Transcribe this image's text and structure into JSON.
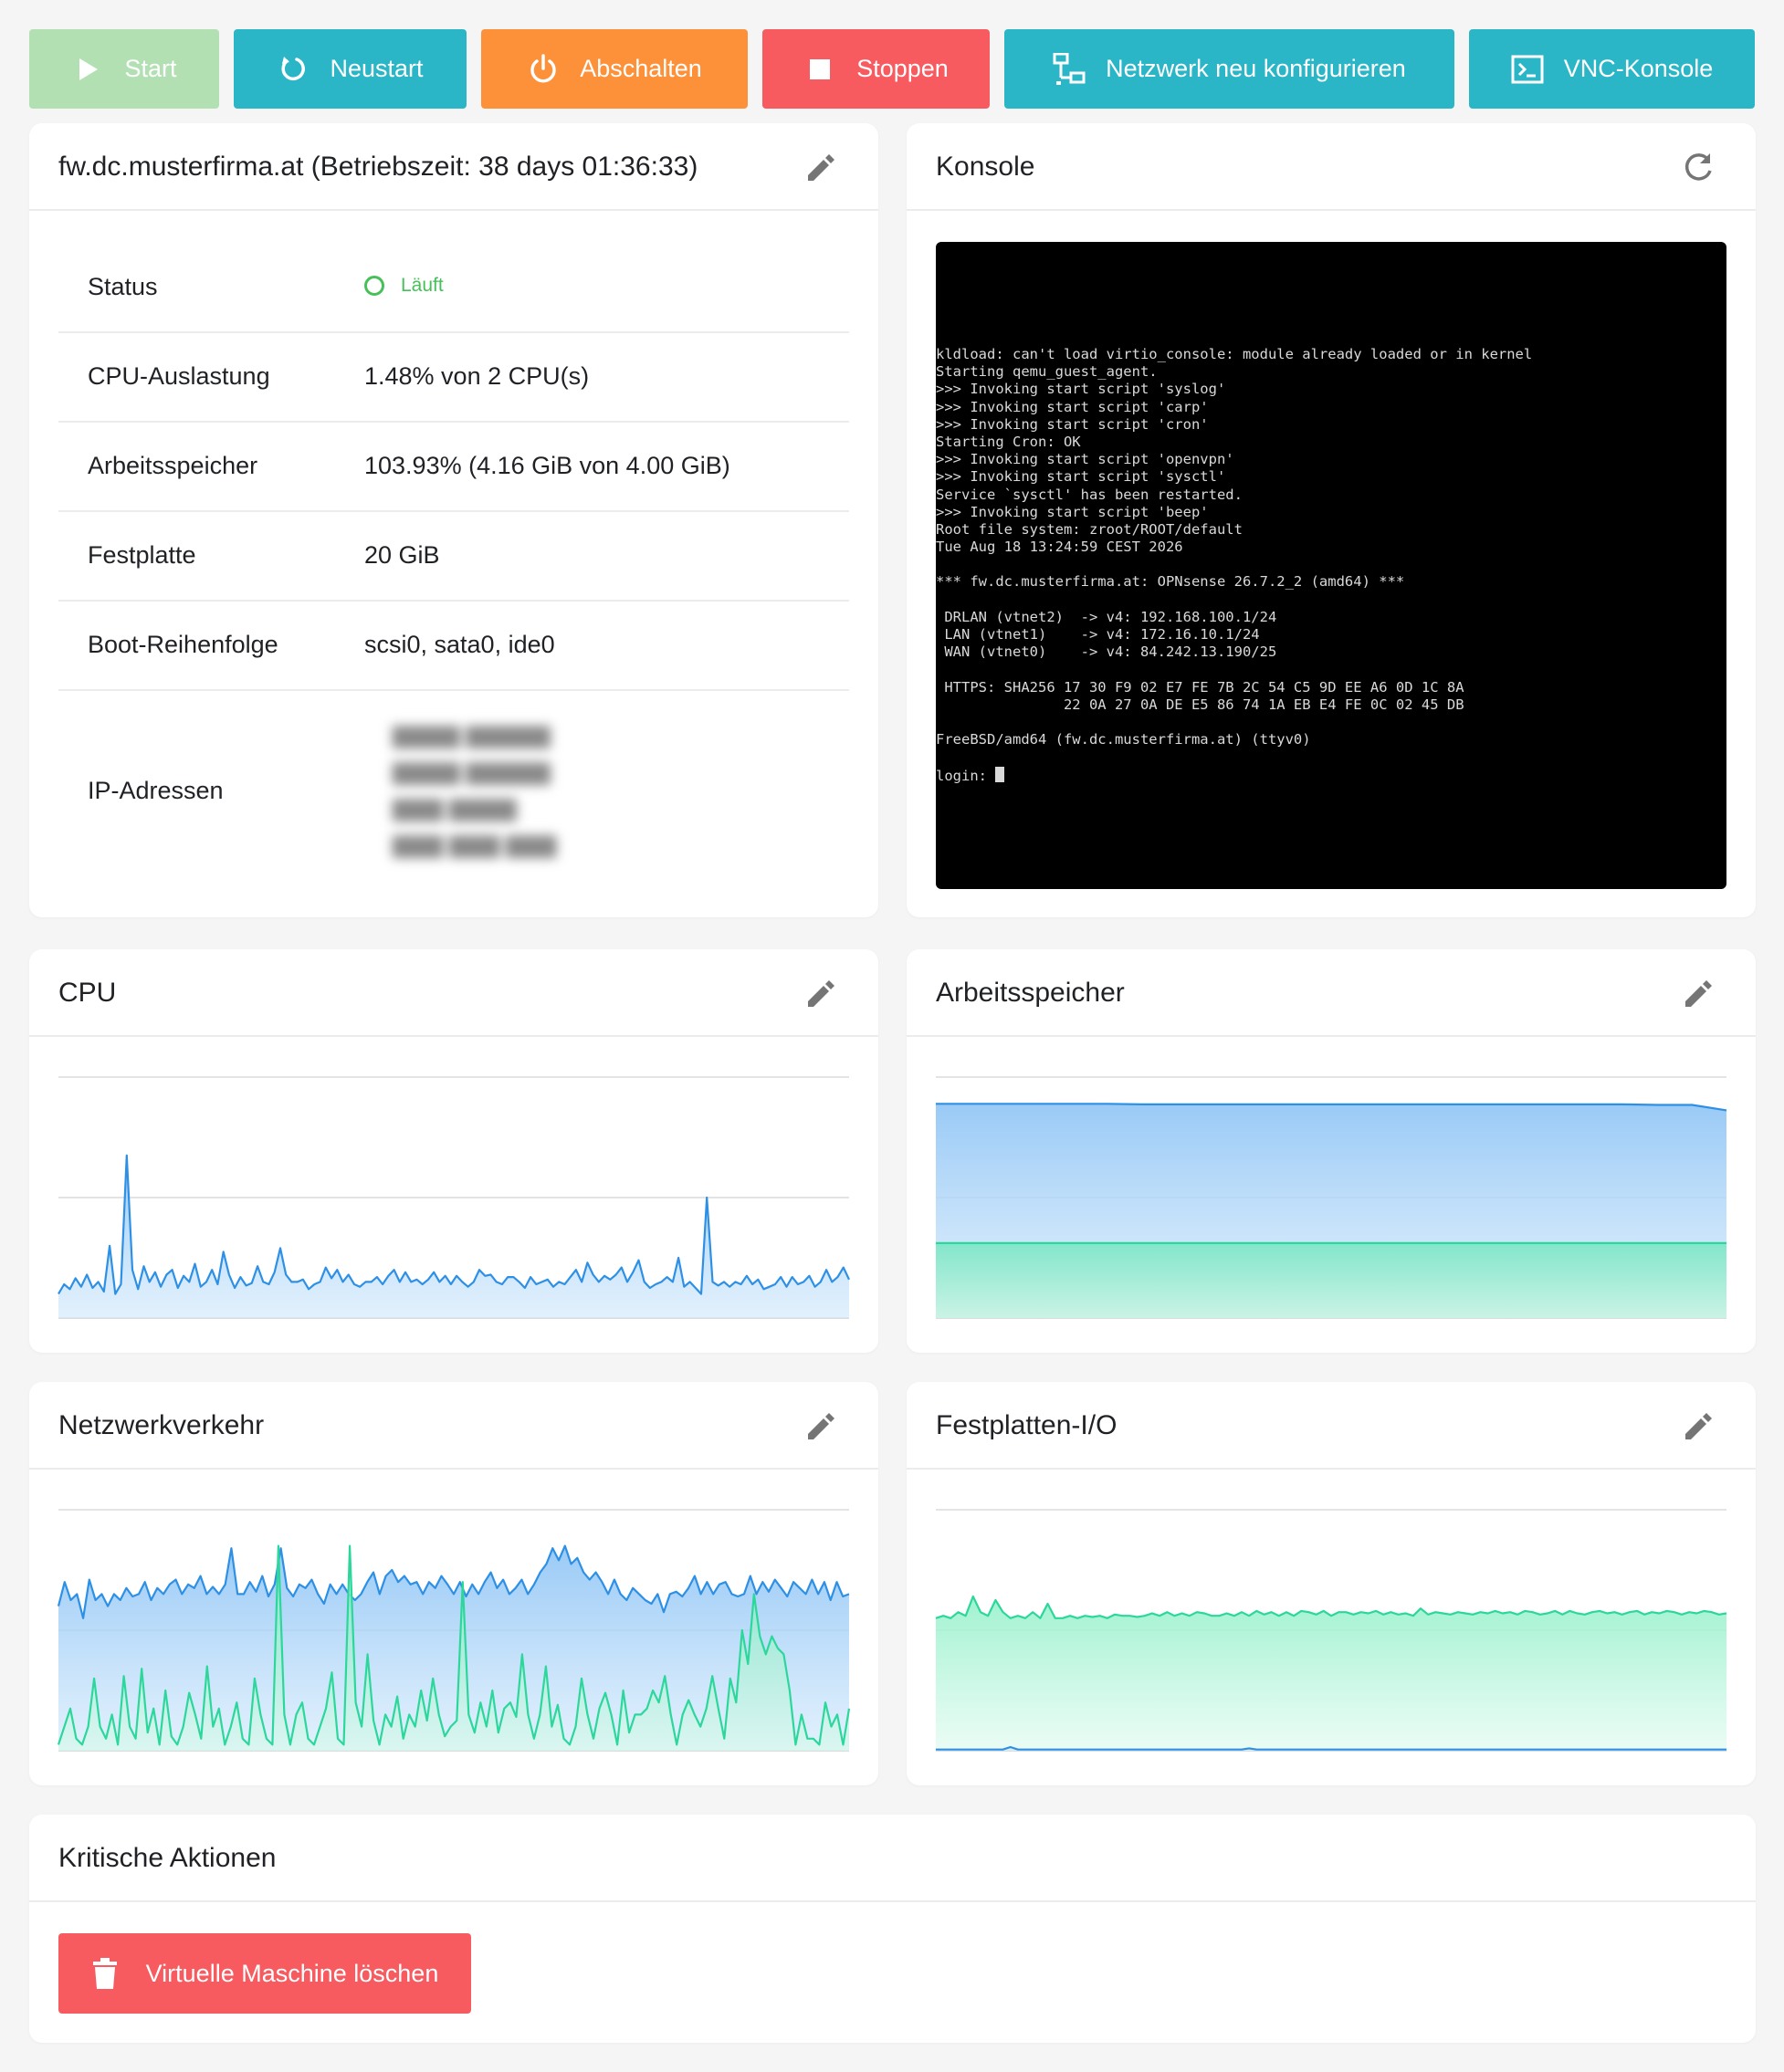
{
  "toolbar": {
    "start": "Start",
    "restart": "Neustart",
    "shutdown": "Abschalten",
    "stop": "Stoppen",
    "network": "Netzwerk neu konfigurieren",
    "vnc": "VNC-Konsole"
  },
  "colors": {
    "green": "#47c05a",
    "teal": "#2ab6c6",
    "orange": "#fd913a",
    "red": "#f75a5f",
    "blue_line": "#2e90e5",
    "green_line": "#2cd79b"
  },
  "summary": {
    "title": "fw.dc.musterfirma.at (Betriebszeit: 38 days 01:36:33)",
    "rows": {
      "status_label": "Status",
      "status_value": "Läuft",
      "cpu_label": "CPU-Auslastung",
      "cpu_value": "1.48% von 2 CPU(s)",
      "mem_label": "Arbeitsspeicher",
      "mem_value": "103.93% (4.16 GiB von 4.00 GiB)",
      "disk_label": "Festplatte",
      "disk_value": "20 GiB",
      "boot_label": "Boot-Reihenfolge",
      "boot_value": "scsi0, sata0, ide0",
      "ip_label": "IP-Adressen"
    }
  },
  "console": {
    "title": "Konsole",
    "lines": [
      "kldload: can't load virtio_console: module already loaded or in kernel",
      "Starting qemu_guest_agent.",
      ">>> Invoking start script 'syslog'",
      ">>> Invoking start script 'carp'",
      ">>> Invoking start script 'cron'",
      "Starting Cron: OK",
      ">>> Invoking start script 'openvpn'",
      ">>> Invoking start script 'sysctl'",
      "Service `sysctl' has been restarted.",
      ">>> Invoking start script 'beep'",
      "Root file system: zroot/ROOT/default",
      "Tue Aug 18 13:24:59 CEST 2026",
      "",
      "*** fw.dc.musterfirma.at: OPNsense 26.7.2_2 (amd64) ***",
      "",
      " DRLAN (vtnet2)  -> v4: 192.168.100.1/24",
      " LAN (vtnet1)    -> v4: 172.16.10.1/24",
      " WAN (vtnet0)    -> v4: 84.242.13.190/25",
      "",
      " HTTPS: SHA256 17 30 F9 02 E7 FE 7B 2C 54 C5 9D EE A6 0D 1C 8A",
      "               22 0A 27 0A DE E5 86 74 1A EB E4 FE 0C 02 45 DB",
      "",
      "FreeBSD/amd64 (fw.dc.musterfirma.at) (ttyv0)",
      "",
      "login: "
    ]
  },
  "cpu_card": {
    "title": "CPU"
  },
  "mem_card": {
    "title": "Arbeitsspeicher"
  },
  "net_card": {
    "title": "Netzwerkverkehr"
  },
  "disk_card": {
    "title": "Festplatten-I/O"
  },
  "critical": {
    "title": "Kritische Aktionen",
    "delete_label": "Virtuelle Maschine löschen"
  },
  "chart_data": [
    {
      "type": "area",
      "chart": "cpu",
      "grid": true,
      "ylim": [
        0,
        2
      ],
      "series": [
        {
          "values": [
            0.2,
            0.28,
            0.24,
            0.33,
            0.26,
            0.36,
            0.25,
            0.3,
            0.22,
            0.6,
            0.2,
            0.28,
            1.35,
            0.4,
            0.24,
            0.43,
            0.3,
            0.38,
            0.26,
            0.36,
            0.4,
            0.25,
            0.35,
            0.3,
            0.45,
            0.26,
            0.3,
            0.4,
            0.28,
            0.55,
            0.36,
            0.25,
            0.34,
            0.27,
            0.29,
            0.43,
            0.3,
            0.28,
            0.38,
            0.58,
            0.36,
            0.3,
            0.3,
            0.32,
            0.24,
            0.28,
            0.3,
            0.42,
            0.33,
            0.4,
            0.3,
            0.36,
            0.28,
            0.26,
            0.3,
            0.3,
            0.34,
            0.28,
            0.35,
            0.4,
            0.3,
            0.38,
            0.3,
            0.32,
            0.28,
            0.32,
            0.38,
            0.3,
            0.35,
            0.28,
            0.35,
            0.3,
            0.26,
            0.3,
            0.4,
            0.35,
            0.36,
            0.3,
            0.28,
            0.34,
            0.34,
            0.3,
            0.25,
            0.34,
            0.28,
            0.3,
            0.32,
            0.26,
            0.3,
            0.28,
            0.34,
            0.4,
            0.3,
            0.46,
            0.36,
            0.3,
            0.35,
            0.32,
            0.36,
            0.42,
            0.3,
            0.38,
            0.48,
            0.3,
            0.25,
            0.28,
            0.3,
            0.34,
            0.3,
            0.5,
            0.26,
            0.3,
            0.25,
            0.2,
            1.0,
            0.3,
            0.27,
            0.3,
            0.26,
            0.3,
            0.28,
            0.35,
            0.28,
            0.32,
            0.24,
            0.26,
            0.28,
            0.34,
            0.26,
            0.34,
            0.28,
            0.3,
            0.35,
            0.26,
            0.3,
            0.4,
            0.3,
            0.34,
            0.42,
            0.32
          ]
        }
      ]
    },
    {
      "type": "area",
      "chart": "memory",
      "grid": true,
      "ylim": [
        0,
        4.5
      ],
      "series": [
        {
          "name": "total",
          "values": [
            4.0,
            4.0,
            4.0,
            4.0,
            4.0,
            4.0,
            3.99,
            3.99,
            3.99,
            3.99,
            3.99,
            3.99,
            3.99,
            3.99,
            3.99,
            3.99,
            3.99,
            3.99,
            3.99,
            3.99,
            3.99,
            3.98,
            3.98,
            3.88
          ]
        },
        {
          "name": "used",
          "values": [
            1.4,
            1.4,
            1.4,
            1.4,
            1.4,
            1.4,
            1.4,
            1.4,
            1.4,
            1.4,
            1.4,
            1.4,
            1.4,
            1.4,
            1.4,
            1.4,
            1.4,
            1.4,
            1.4,
            1.4,
            1.4,
            1.4,
            1.4,
            1.4
          ]
        }
      ]
    },
    {
      "type": "area",
      "chart": "network",
      "grid": true,
      "ylim": [
        0,
        2
      ],
      "series": [
        {
          "name": "in",
          "values": [
            1.2,
            1.4,
            1.25,
            1.3,
            1.1,
            1.42,
            1.25,
            1.3,
            1.2,
            1.3,
            1.25,
            1.35,
            1.28,
            1.3,
            1.4,
            1.25,
            1.35,
            1.3,
            1.38,
            1.42,
            1.3,
            1.38,
            1.35,
            1.45,
            1.3,
            1.36,
            1.3,
            1.38,
            1.68,
            1.3,
            1.3,
            1.4,
            1.32,
            1.45,
            1.28,
            1.38,
            1.68,
            1.35,
            1.28,
            1.38,
            1.35,
            1.42,
            1.3,
            1.22,
            1.38,
            1.3,
            1.38,
            1.3,
            1.25,
            1.3,
            1.4,
            1.48,
            1.3,
            1.45,
            1.5,
            1.4,
            1.45,
            1.38,
            1.4,
            1.3,
            1.4,
            1.35,
            1.45,
            1.38,
            1.3,
            1.4,
            1.28,
            1.38,
            1.3,
            1.4,
            1.48,
            1.35,
            1.42,
            1.3,
            1.35,
            1.42,
            1.3,
            1.38,
            1.48,
            1.55,
            1.68,
            1.58,
            1.7,
            1.55,
            1.6,
            1.48,
            1.42,
            1.48,
            1.4,
            1.3,
            1.42,
            1.3,
            1.25,
            1.35,
            1.3,
            1.25,
            1.22,
            1.3,
            1.15,
            1.3,
            1.32,
            1.28,
            1.35,
            1.45,
            1.3,
            1.4,
            1.3,
            1.38,
            1.4,
            1.3,
            1.28,
            1.3,
            1.45,
            1.3,
            1.4,
            1.32,
            1.42,
            1.35,
            1.28,
            1.4,
            1.35,
            1.3,
            1.42,
            1.3,
            1.4,
            1.25,
            1.4,
            1.28,
            1.3
          ]
        },
        {
          "name": "out",
          "values": [
            0.05,
            0.2,
            0.35,
            0.1,
            0.05,
            0.2,
            0.6,
            0.2,
            0.1,
            0.3,
            0.05,
            0.62,
            0.2,
            0.1,
            0.68,
            0.15,
            0.35,
            0.05,
            0.5,
            0.12,
            0.05,
            0.2,
            0.48,
            0.3,
            0.1,
            0.7,
            0.2,
            0.35,
            0.05,
            0.2,
            0.4,
            0.1,
            0.05,
            0.6,
            0.3,
            0.1,
            0.05,
            1.7,
            0.3,
            0.05,
            0.3,
            0.4,
            0.1,
            0.05,
            0.2,
            0.35,
            0.65,
            0.1,
            0.05,
            1.7,
            0.4,
            0.2,
            0.8,
            0.25,
            0.05,
            0.3,
            0.2,
            0.45,
            0.1,
            0.3,
            0.2,
            0.5,
            0.25,
            0.6,
            0.3,
            0.12,
            0.2,
            0.25,
            1.4,
            0.3,
            0.15,
            0.4,
            0.2,
            0.5,
            0.15,
            0.35,
            0.4,
            0.28,
            0.8,
            0.3,
            0.1,
            0.3,
            0.7,
            0.2,
            0.38,
            0.1,
            0.05,
            0.2,
            0.6,
            0.3,
            0.1,
            0.35,
            0.48,
            0.3,
            0.05,
            0.5,
            0.15,
            0.3,
            0.3,
            0.35,
            0.5,
            0.4,
            0.62,
            0.3,
            0.05,
            0.3,
            0.42,
            0.3,
            0.2,
            0.35,
            0.62,
            0.35,
            0.1,
            0.6,
            0.4,
            1.0,
            0.72,
            1.3,
            0.95,
            0.8,
            0.95,
            0.85,
            0.8,
            0.5,
            0.05,
            0.3,
            0.1,
            0.1,
            0.05,
            0.4,
            0.2,
            0.3,
            0.05,
            0.35
          ]
        }
      ]
    },
    {
      "type": "area",
      "chart": "disk_io",
      "grid": true,
      "ylim": [
        0,
        2
      ],
      "series": [
        {
          "name": "write",
          "values": [
            1.1,
            1.12,
            1.1,
            1.15,
            1.12,
            1.28,
            1.15,
            1.12,
            1.25,
            1.15,
            1.1,
            1.12,
            1.1,
            1.15,
            1.1,
            1.22,
            1.1,
            1.1,
            1.12,
            1.1,
            1.12,
            1.11,
            1.12,
            1.1,
            1.13,
            1.12,
            1.12,
            1.11,
            1.12,
            1.14,
            1.12,
            1.15,
            1.12,
            1.14,
            1.12,
            1.15,
            1.14,
            1.12,
            1.12,
            1.14,
            1.12,
            1.15,
            1.12,
            1.16,
            1.13,
            1.15,
            1.12,
            1.15,
            1.12,
            1.16,
            1.15,
            1.13,
            1.16,
            1.12,
            1.15,
            1.15,
            1.13,
            1.15,
            1.14,
            1.16,
            1.13,
            1.15,
            1.13,
            1.14,
            1.12,
            1.18,
            1.13,
            1.15,
            1.14,
            1.13,
            1.15,
            1.14,
            1.13,
            1.15,
            1.14,
            1.16,
            1.14,
            1.15,
            1.13,
            1.16,
            1.15,
            1.13,
            1.14,
            1.16,
            1.13,
            1.16,
            1.14,
            1.13,
            1.15,
            1.16,
            1.14,
            1.15,
            1.13,
            1.15,
            1.16,
            1.13,
            1.15,
            1.14,
            1.16,
            1.15,
            1.13,
            1.15,
            1.14,
            1.16,
            1.15,
            1.13,
            1.14
          ]
        },
        {
          "name": "read",
          "values": [
            0.01,
            0.01,
            0.01,
            0.01,
            0.01,
            0.01,
            0.01,
            0.01,
            0.01,
            0.01,
            0.03,
            0.01,
            0.01,
            0.01,
            0.01,
            0.01,
            0.01,
            0.01,
            0.01,
            0.01,
            0.01,
            0.01,
            0.01,
            0.01,
            0.01,
            0.01,
            0.01,
            0.01,
            0.01,
            0.01,
            0.01,
            0.01,
            0.01,
            0.01,
            0.01,
            0.01,
            0.01,
            0.01,
            0.01,
            0.01,
            0.01,
            0.01,
            0.02,
            0.01,
            0.01,
            0.01,
            0.01,
            0.01,
            0.01,
            0.01,
            0.01,
            0.01,
            0.01,
            0.01,
            0.01,
            0.01,
            0.01,
            0.01,
            0.01,
            0.01,
            0.01,
            0.01,
            0.01,
            0.01,
            0.01,
            0.01,
            0.01,
            0.01,
            0.01,
            0.01,
            0.01,
            0.01,
            0.01,
            0.01,
            0.01,
            0.01,
            0.01,
            0.01,
            0.01,
            0.01,
            0.01,
            0.01,
            0.01,
            0.01,
            0.01,
            0.01,
            0.01,
            0.01,
            0.01,
            0.01,
            0.01,
            0.01,
            0.01,
            0.01,
            0.01,
            0.01,
            0.01,
            0.01,
            0.01,
            0.01,
            0.01,
            0.01,
            0.01,
            0.01,
            0.01,
            0.01,
            0.01
          ]
        }
      ]
    }
  ]
}
